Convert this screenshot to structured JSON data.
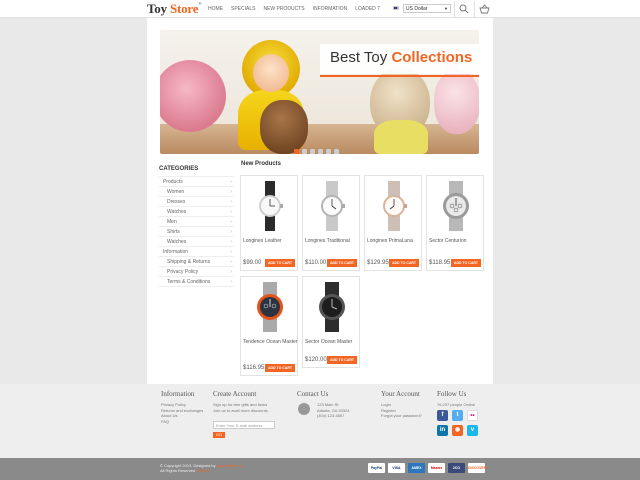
{
  "header": {
    "logo_main": "Toy",
    "logo_accent": "Store",
    "logo_mark": "®",
    "nav": [
      "HOME",
      "SPECIALS",
      "NEW PRODUCTS",
      "INFORMATION",
      "LOADED 7"
    ],
    "currency": "US Dollar",
    "colors": {
      "accent": "#f26522"
    }
  },
  "banner": {
    "title_plain": "Best Toy",
    "title_accent": "Collections",
    "slides": 6,
    "active_slide": 1
  },
  "sidebar": {
    "title": "CATEGORIES",
    "items": [
      {
        "label": "Products",
        "level": 0
      },
      {
        "label": "Women",
        "level": 1
      },
      {
        "label": "Dresses",
        "level": 1
      },
      {
        "label": "Watches",
        "level": 1
      },
      {
        "label": "Men",
        "level": 1
      },
      {
        "label": "Shirts",
        "level": 1
      },
      {
        "label": "Watches",
        "level": 1
      },
      {
        "label": "Information",
        "level": 0
      },
      {
        "label": "Shipping & Returns",
        "level": 1
      },
      {
        "label": "Privacy Policy",
        "level": 1
      },
      {
        "label": "Terms & Conditions",
        "level": 1
      }
    ]
  },
  "products": {
    "title": "New Products",
    "add_label": "ADD TO CART",
    "items": [
      {
        "name": "Longines Leather",
        "price": "$99.00",
        "icon": "watch-leather-icon"
      },
      {
        "name": "Longines Traditional",
        "price": "$110.00",
        "icon": "watch-steel-icon"
      },
      {
        "name": "Longines PrimaLuna",
        "price": "$129.95",
        "icon": "watch-rose-icon"
      },
      {
        "name": "Sector Centurion",
        "price": "$118.95",
        "icon": "watch-chrono-icon"
      },
      {
        "name": "Tendence Ocean Master",
        "price": "$116.95",
        "icon": "watch-ocean-icon"
      },
      {
        "name": "Sector Ocean Master",
        "price": "$120.00",
        "icon": "watch-black-icon"
      }
    ]
  },
  "footer": {
    "information": {
      "title": "Information",
      "links": [
        "Privacy Policy",
        "Returns and exchanges",
        "About Us",
        "FAQ"
      ]
    },
    "create_account": {
      "title": "Create Account",
      "text1": "Sign up for free gifts and items",
      "text2": "Join us to avail more discounts",
      "placeholder": "Enter Your E-mail address",
      "go": "GO"
    },
    "contact": {
      "title": "Contact Us",
      "lines": [
        "123 Main St",
        "Atlanta, GA 30324",
        "(404) 123-4567"
      ]
    },
    "your_account": {
      "title": "Your Account",
      "links": [
        "Login",
        "Register",
        "Forgot your password?"
      ]
    },
    "follow": {
      "title": "Follow Us",
      "online": "76,237 people Online",
      "icons": [
        "facebook-icon",
        "twitter-icon",
        "flickr-icon",
        "linkedin-icon",
        "rss-icon",
        "vimeo-icon"
      ]
    },
    "copyright": {
      "line1": "© Copyright 2013. Designed by",
      "designer": "mydomain.com",
      "line2": "All Rights Reserved",
      "line2_accent": "E-Shop"
    },
    "payments": [
      "PayPal",
      "VISA",
      "AMEX",
      "Master",
      "2CO",
      "DISCOVER"
    ]
  }
}
